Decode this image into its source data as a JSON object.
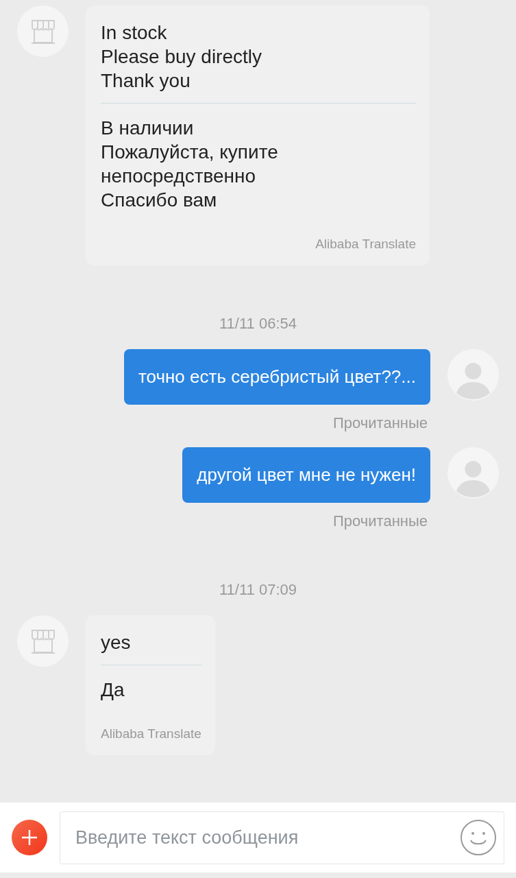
{
  "messages": [
    {
      "kind": "incoming",
      "original": "In stock\nPlease buy directly\nThank you",
      "translation": "В наличии\nПожалуйста, купите непосредственно\nСпасибо вам",
      "source": "Alibaba Translate"
    },
    {
      "kind": "timestamp",
      "text": "11/11 06:54"
    },
    {
      "kind": "outgoing",
      "text": "точно есть серебристый цвет??...",
      "status": "Прочитанные"
    },
    {
      "kind": "outgoing",
      "text": "другой цвет мне не нужен!",
      "status": "Прочитанные"
    },
    {
      "kind": "timestamp",
      "text": "11/11 07:09"
    },
    {
      "kind": "incoming",
      "original": "yes",
      "translation": "Да",
      "source": "Alibaba Translate"
    }
  ],
  "composer": {
    "placeholder": "Введите текст сообщения"
  }
}
